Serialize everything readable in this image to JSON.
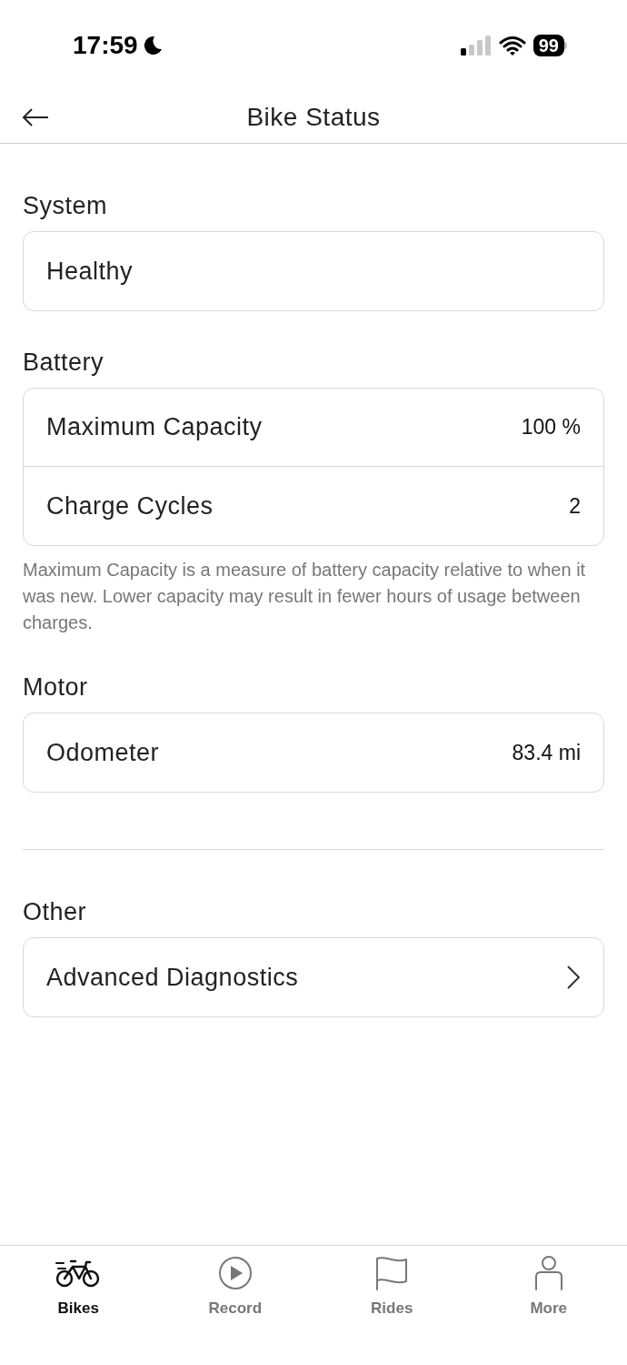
{
  "status_bar": {
    "time": "17:59",
    "battery": "99"
  },
  "header": {
    "title": "Bike Status"
  },
  "sections": [
    {
      "title": "System",
      "rows": [
        {
          "kind": "plain",
          "label": "Healthy"
        }
      ]
    },
    {
      "title": "Battery",
      "rows": [
        {
          "kind": "value",
          "label": "Maximum Capacity",
          "value": "100 %"
        },
        {
          "kind": "value",
          "label": "Charge Cycles",
          "value": "2"
        }
      ],
      "note": "Maximum Capacity is a measure of battery capacity relative to when it was new. Lower capacity may result in fewer hours of usage between charges."
    },
    {
      "title": "Motor",
      "rows": [
        {
          "kind": "value",
          "label": "Odometer",
          "value": "83.4 mi"
        }
      ],
      "divider_after": true
    },
    {
      "title": "Other",
      "rows": [
        {
          "kind": "link",
          "label": "Advanced Diagnostics"
        }
      ]
    }
  ],
  "tabs": [
    {
      "kind": "bike",
      "label": "Bikes",
      "selected": true
    },
    {
      "kind": "play",
      "label": "Record",
      "selected": false
    },
    {
      "kind": "flag",
      "label": "Rides",
      "selected": false
    },
    {
      "kind": "person",
      "label": "More",
      "selected": false
    }
  ]
}
